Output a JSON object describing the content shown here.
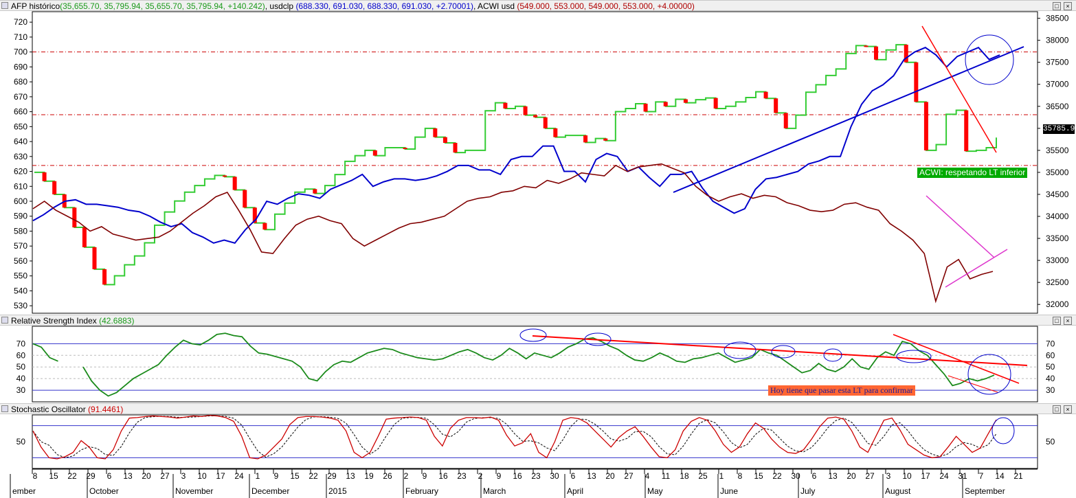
{
  "panes": {
    "price": {
      "legend": [
        {
          "label": "AFP histórico",
          "color": "#000000"
        },
        {
          "label": "(35,655.70, 35,795.94, 35,655.70, 35,795.94, +140.242)",
          "color": "#1a9a1a"
        },
        {
          "label": ", usdclp",
          "color": "#000000"
        },
        {
          "label": "(688.330, 691.030, 688.330, 691.030, +2.70001)",
          "color": "#0000cc"
        },
        {
          "label": ", ACWI usd",
          "color": "#000000"
        },
        {
          "label": "(549.000, 553.000, 549.000, 553.000, +4.00000)",
          "color": "#b00000"
        }
      ],
      "last_value_label": "35785.94",
      "annotation": "ACWI: respetando LT inferior"
    },
    "rsi": {
      "legend": [
        {
          "label": "Relative Strength Index",
          "color": "#000000"
        },
        {
          "label": "(42.6883)",
          "color": "#1a9a1a"
        }
      ],
      "annotation": "Hoy tiene que pasar esta LT para confirmar"
    },
    "stoch": {
      "legend": [
        {
          "label": "Stochastic Oscillator",
          "color": "#000000"
        },
        {
          "label": "(91.4461)",
          "color": "#cc0000"
        }
      ]
    }
  },
  "colors": {
    "up": "#33cc33",
    "down": "#ff0000",
    "usd": "#0000cc",
    "acwi": "#800000",
    "rsi": "#1a8a1a",
    "trend_red": "#ff0000",
    "trend_blue": "#0000cc",
    "trend_pink": "#dd33cc"
  },
  "chart_data": [
    {
      "type": "line",
      "name": "price-panel",
      "x_day_labels": [
        "8",
        "15",
        "22",
        "29",
        "6",
        "13",
        "20",
        "27",
        "3",
        "10",
        "17",
        "24",
        "1",
        "9",
        "15",
        "22",
        "29",
        "13",
        "19",
        "26",
        "2",
        "9",
        "16",
        "23",
        "2",
        "9",
        "16",
        "23",
        "30",
        "6",
        "13",
        "20",
        "27",
        "4",
        "11",
        "18",
        "25",
        "1",
        "8",
        "15",
        "22",
        "30",
        "6",
        "13",
        "20",
        "27",
        "3",
        "10",
        "17",
        "24",
        "31",
        "7",
        "14",
        "21"
      ],
      "x_month_labels": [
        "ember",
        "October",
        "November",
        "December",
        "2015",
        "February",
        "March",
        "April",
        "May",
        "June",
        "July",
        "August",
        "September"
      ],
      "left_axis": {
        "ticks": [
          530,
          540,
          550,
          560,
          570,
          580,
          590,
          600,
          610,
          620,
          630,
          640,
          650,
          660,
          670,
          680,
          690,
          700,
          710,
          720
        ],
        "ylim": [
          525,
          727
        ]
      },
      "right_axis": {
        "ticks": [
          32000,
          32500,
          33000,
          33500,
          34000,
          34500,
          35000,
          35500,
          36000,
          36500,
          37000,
          37500,
          38000,
          38500
        ],
        "ylim": [
          31800,
          38650
        ]
      },
      "series": [
        {
          "name": "AFP histórico",
          "axis": "right",
          "values": [
            35000,
            34800,
            34500,
            34200,
            33750,
            33300,
            32800,
            32450,
            32650,
            32900,
            33100,
            33400,
            33800,
            34100,
            34350,
            34550,
            34700,
            34850,
            34930,
            34900,
            34600,
            34200,
            33850,
            33700,
            34050,
            34300,
            34550,
            34620,
            34520,
            34700,
            34950,
            35250,
            35380,
            35500,
            35380,
            35560,
            35560,
            35530,
            35800,
            36000,
            35800,
            35670,
            35450,
            35500,
            35500,
            36400,
            36580,
            36450,
            36500,
            36300,
            36250,
            36000,
            35800,
            35840,
            35840,
            35680,
            35770,
            35720,
            36380,
            36450,
            36560,
            36380,
            36600,
            36500,
            36660,
            36580,
            36650,
            36690,
            36450,
            36500,
            36600,
            36700,
            36830,
            36680,
            36350,
            36000,
            36300,
            36820,
            36990,
            37200,
            37350,
            37700,
            37880,
            37860,
            37560,
            37780,
            37900,
            37500,
            36600,
            35500,
            35630,
            36320,
            36410,
            35480,
            35500,
            35560,
            35790
          ]
        },
        {
          "name": "usdclp",
          "axis": "left",
          "values": [
            587,
            591,
            596,
            600,
            601,
            598,
            598,
            597,
            596,
            594,
            593,
            590,
            586,
            583,
            585,
            579,
            576,
            572,
            574,
            572,
            581,
            588,
            600,
            598,
            602,
            605,
            604,
            602,
            608,
            611,
            614,
            618,
            610,
            613,
            615,
            615,
            614,
            615,
            617,
            620,
            624,
            624,
            621,
            621,
            618,
            628,
            630,
            630,
            637,
            637,
            620,
            620,
            613,
            628,
            632,
            630,
            620,
            623,
            616,
            610,
            618,
            618,
            620,
            609,
            600,
            596,
            592,
            595,
            608,
            615,
            616,
            618,
            620,
            625,
            627,
            630,
            630,
            650,
            665,
            674,
            678,
            684,
            695,
            700,
            703,
            698,
            690,
            697,
            700,
            703,
            695,
            698
          ]
        },
        {
          "name": "ACWI usd",
          "axis": "left",
          "values": [
            595,
            600,
            594,
            590,
            586,
            580,
            583,
            578,
            576,
            574,
            575,
            576,
            580,
            586,
            592,
            597,
            603,
            606,
            594,
            581,
            566,
            565,
            575,
            584,
            588,
            590,
            587,
            585,
            575,
            570,
            574,
            578,
            582,
            585,
            586,
            588,
            590,
            595,
            600,
            602,
            603,
            606,
            607,
            610,
            609,
            614,
            612,
            615,
            619,
            618,
            617,
            624,
            620,
            623,
            624,
            625,
            622,
            619,
            610,
            604,
            600,
            603,
            605,
            602,
            604,
            603,
            599,
            597,
            594,
            593,
            594,
            598,
            599,
            596,
            594,
            585,
            580,
            574,
            565,
            533,
            556,
            561,
            548,
            551,
            553
          ]
        }
      ],
      "horizontal_lines_left": [
        700,
        658,
        624
      ],
      "annotation": "ACWI: respetando LT inferior"
    },
    {
      "type": "line",
      "name": "Relative Strength Index",
      "ylim": [
        20,
        85
      ],
      "ticks": [
        30,
        40,
        50,
        60,
        70
      ],
      "levels": [
        70,
        30
      ],
      "series": [
        {
          "name": "Relative Strength Index",
          "values": [
            70,
            67,
            58,
            55,
            61,
            60,
            50,
            38,
            30,
            25,
            28,
            34,
            40,
            44,
            48,
            52,
            60,
            67,
            73,
            70,
            69,
            73,
            78,
            79,
            77,
            76,
            68,
            62,
            61,
            59,
            57,
            55,
            50,
            40,
            38,
            46,
            52,
            55,
            54,
            58,
            62,
            64,
            66,
            65,
            62,
            60,
            58,
            57,
            56,
            57,
            60,
            63,
            65,
            62,
            58,
            56,
            60,
            66,
            62,
            57,
            62,
            60,
            58,
            62,
            67,
            70,
            74,
            75,
            72,
            68,
            65,
            60,
            56,
            55,
            58,
            62,
            59,
            55,
            54,
            57,
            58,
            60,
            62,
            58,
            54,
            56,
            58,
            65,
            62,
            60,
            55,
            50,
            45,
            47,
            53,
            48,
            46,
            50,
            57,
            50,
            48,
            58,
            63,
            60,
            72,
            70,
            64,
            60,
            52,
            44,
            34,
            36,
            40,
            38,
            40,
            43
          ]
        }
      ],
      "last_value": 42.6883,
      "annotation": "Hoy tiene que pasar esta LT para confirmar"
    },
    {
      "type": "line",
      "name": "Stochastic Oscillator",
      "ylim": [
        0,
        100
      ],
      "ticks": [
        50
      ],
      "levels": [
        80,
        20
      ],
      "series": [
        {
          "name": "Stochastic Oscillator",
          "values": [
            70,
            40,
            20,
            18,
            22,
            30,
            52,
            40,
            20,
            18,
            35,
            70,
            94,
            95,
            97,
            98,
            97,
            96,
            94,
            96,
            98,
            97,
            99,
            98,
            95,
            88,
            60,
            20,
            18,
            25,
            40,
            55,
            82,
            95,
            97,
            97,
            96,
            94,
            90,
            70,
            30,
            20,
            30,
            60,
            92,
            94,
            95,
            96,
            95,
            90,
            60,
            42,
            75,
            90,
            95,
            95,
            94,
            96,
            90,
            62,
            42,
            48,
            65,
            30,
            20,
            50,
            90,
            95,
            93,
            85,
            70,
            55,
            40,
            58,
            70,
            78,
            60,
            40,
            22,
            20,
            35,
            70,
            88,
            95,
            90,
            70,
            45,
            30,
            40,
            65,
            85,
            75,
            55,
            40,
            30,
            28,
            35,
            55,
            78,
            94,
            96,
            92,
            70,
            40,
            30,
            60,
            90,
            94,
            72,
            45,
            35,
            25,
            20,
            22,
            40,
            60,
            45,
            30,
            38,
            65,
            91
          ]
        }
      ],
      "last_value": 91.4461
    }
  ]
}
